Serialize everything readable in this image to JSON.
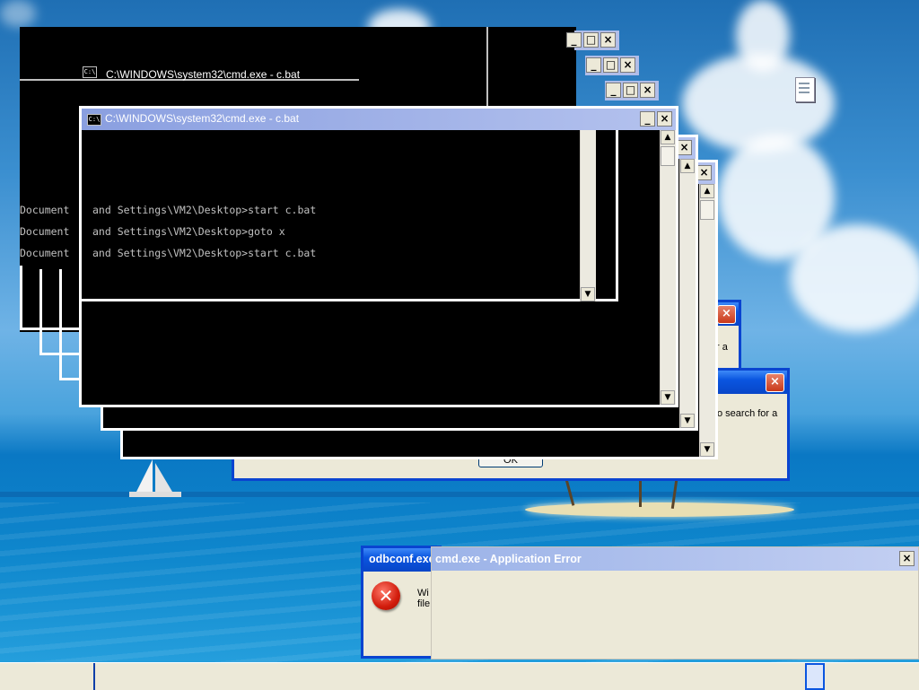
{
  "desktop": {
    "icon": "text-file-icon",
    "colors": {
      "sky": "#3b8fd0",
      "sea": "#0e86cc",
      "sand": "#e9dfb3"
    }
  },
  "cmd_windows": {
    "title": "C:\\WINDOWS\\system32\\cmd.exe - c.bat",
    "icon_label": "C:\\",
    "minimize_label": "_",
    "maximize_label": "□",
    "close_label": "×",
    "scroll_up": "▲",
    "scroll_down": "▼",
    "lines": [
      "Documents and Settings\\VM2\\Desktop>start c.bat",
      "Documents and Settings\\VM2\\Desktop>goto x",
      "Documents and Settings\\VM2\\Desktop>start c.bat"
    ],
    "lines_visible": [
      "and Settings\\VM2\\Desktop>start c.bat",
      "and Settings\\VM2\\Desktop>goto x",
      "and Settings\\VM2\\Desktop>start c.bat"
    ],
    "left_prefix": "Document"
  },
  "bg_dialogs": {
    "partial_text_1": "r a",
    "partial_text_2": "o search for a",
    "ok_label": "OK",
    "close_label": "×"
  },
  "odbconf_dialog": {
    "title": "odbconf.exe",
    "text_line1": "Wi",
    "text_line2": "file",
    "icon": "error-icon"
  },
  "app_error": {
    "title": "cmd.exe - Application Error",
    "close_label": "×"
  },
  "taskbar": {
    "item": "taskbar-button"
  }
}
